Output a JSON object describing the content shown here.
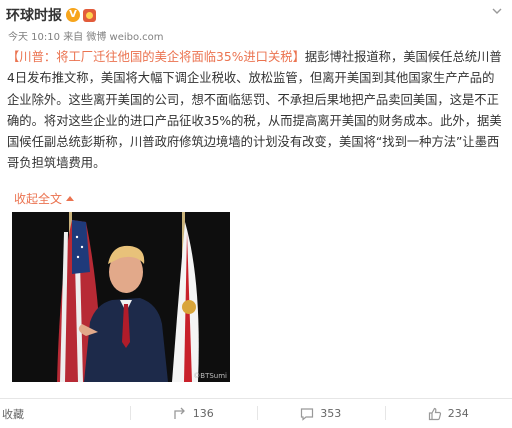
{
  "header": {
    "author": "环球时报",
    "verified_badge": "V"
  },
  "meta": {
    "time": "今天 10:10",
    "source_prefix": "来自",
    "source": "微博 weibo.com"
  },
  "post": {
    "title": "【川普：将工厂迁往他国的美企将面临35%进口关税】",
    "body": "据彭博社报道称，美国候任总统川普4日发布推文称，美国将大幅下调企业税收、放松监管，但离开美国到其他国家生产产品的企业除外。这些离开美国的公司，想不面临惩罚、不承担后果地把产品卖回美国，这是不正确的。将对这些企业的进口产品征收35%的税，从而提高离开美国的财务成本。此外，据美国候任副总统彭斯称，川普政府修筑边境墙的计划没有改变，美国将“找到一种方法”让墨西哥负担筑墙费用。",
    "collapse_label": "收起全文"
  },
  "image": {
    "watermark": "©BTSumi"
  },
  "actions": {
    "favorite_label": "收藏",
    "repost_count": "136",
    "comment_count": "353",
    "like_count": "234"
  },
  "colors": {
    "accent": "#eb7350",
    "verified": "#f7a51c",
    "text": "#333333",
    "meta": "#808080"
  }
}
